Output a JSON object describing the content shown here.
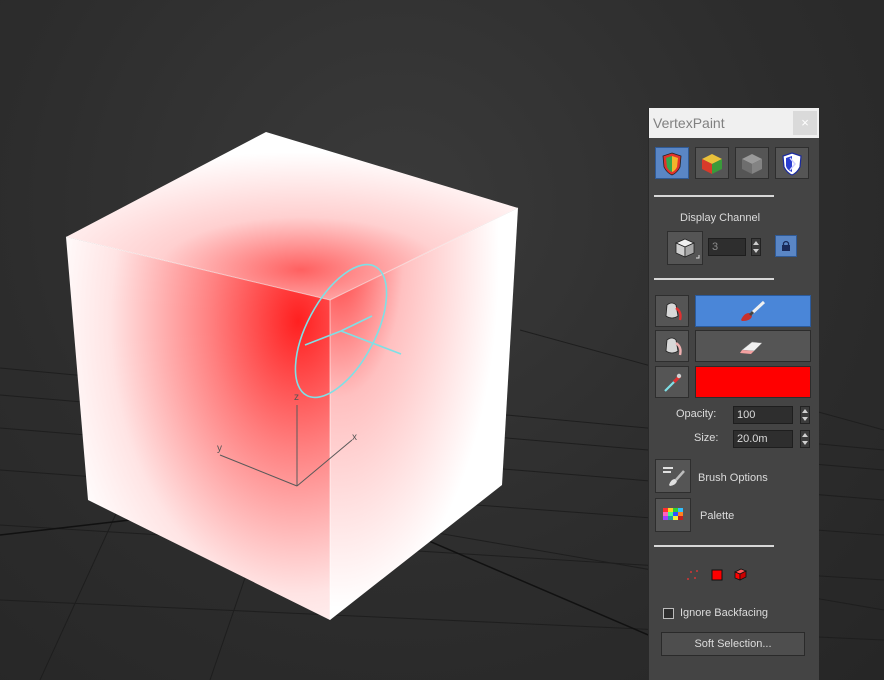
{
  "viewport": {
    "axis_labels": {
      "x": "x",
      "y": "y",
      "z": "z"
    },
    "colors": {
      "paint": "#ff0000",
      "brush_ring": "#7fe0e6",
      "background": "#2d2d2d"
    }
  },
  "panel": {
    "title": "VertexPaint",
    "close_glyph": "×",
    "toolbar_icons": [
      "vertex-paint-icon",
      "vertex-color-cube-icon",
      "gray-cube-icon",
      "shield-blue-icon"
    ],
    "display_channel": {
      "label": "Display Channel",
      "value": "3",
      "lock_icon": "lock-icon"
    },
    "paint_tools": {
      "paint_color": "#ff0000",
      "paint_active_color": "#4a86d8"
    },
    "opacity": {
      "label": "Opacity:",
      "value": "100"
    },
    "size": {
      "label": "Size:",
      "value": "20.0m"
    },
    "brush_options_label": "Brush Options",
    "palette_label": "Palette",
    "ignore_backfacing": {
      "label": "Ignore Backfacing",
      "checked": false
    },
    "soft_selection_label": "Soft Selection..."
  }
}
